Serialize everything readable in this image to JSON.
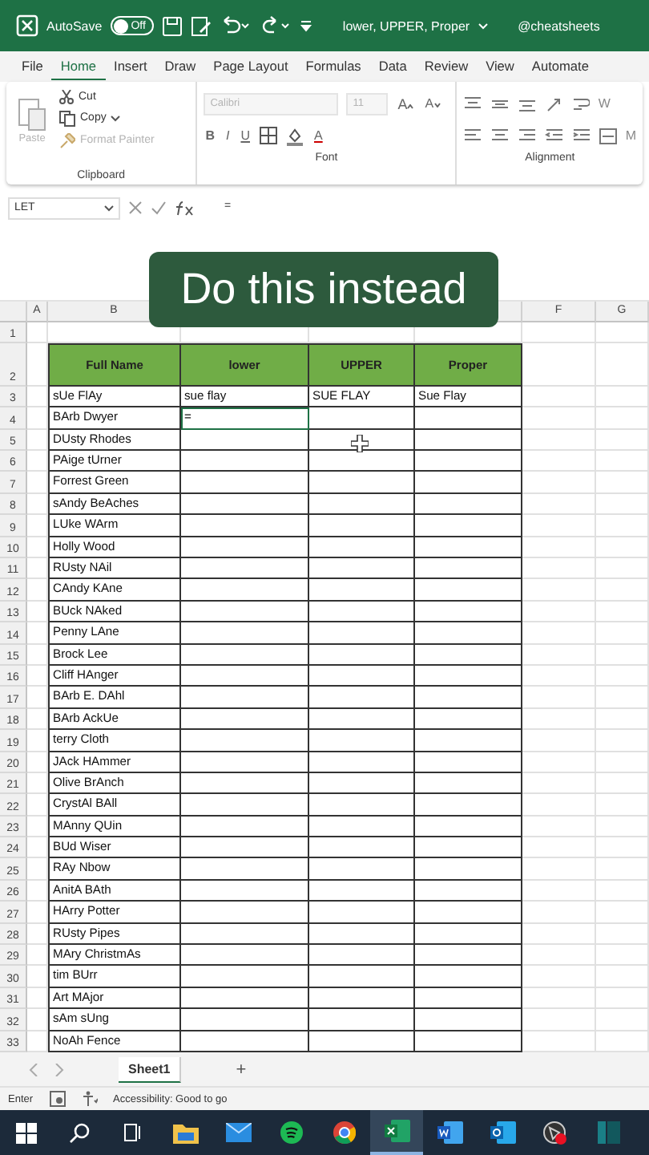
{
  "title_bar": {
    "autosave_label": "AutoSave",
    "autosave": {
      "on": false,
      "label": "Off"
    },
    "document_title": "lower, UPPER, Proper",
    "account": "@cheatsheets"
  },
  "menu_tabs": [
    {
      "label": "File",
      "selected": false
    },
    {
      "label": "Home",
      "selected": true
    },
    {
      "label": "Insert",
      "selected": false
    },
    {
      "label": "Draw",
      "selected": false
    },
    {
      "label": "Page Layout",
      "selected": false
    },
    {
      "label": "Formulas",
      "selected": false
    },
    {
      "label": "Data",
      "selected": false
    },
    {
      "label": "Review",
      "selected": false
    },
    {
      "label": "View",
      "selected": false
    },
    {
      "label": "Automate",
      "selected": false
    }
  ],
  "ribbon": {
    "clipboard": {
      "label": "Clipboard",
      "paste": {
        "label": "Paste",
        "disabled": true
      },
      "cut": {
        "label": "Cut",
        "disabled": false
      },
      "copy": {
        "label": "Copy",
        "disabled": false
      },
      "format_painter": {
        "label": "Format Painter",
        "disabled": true
      }
    },
    "font": {
      "label": "Font",
      "font_name": "Calibri",
      "font_size": "11",
      "disabled": true,
      "bold": "B",
      "italic": "I",
      "underline": "U",
      "font_color": "A",
      "grow": "A",
      "shrink": "A"
    },
    "alignment": {
      "label": "Alignment",
      "wrap": "W",
      "merge": "M"
    }
  },
  "formula_bar": {
    "name_box": "LET",
    "formula": "="
  },
  "caption": "Do this instead",
  "column_headers_left": [
    "A",
    "B"
  ],
  "column_headers_right": [
    "F",
    "G"
  ],
  "blank_row": {
    "number": "1"
  },
  "header_row": {
    "number": "2",
    "cells": [
      "Full Name",
      "lower",
      "UPPER",
      "Proper"
    ]
  },
  "rows": [
    {
      "number": "3",
      "cells": [
        "sUe FlAy",
        "sue flay",
        "SUE FLAY",
        "Sue Flay"
      ]
    },
    {
      "number": "4",
      "cells": [
        "BArb Dwyer",
        {
          "text": "=",
          "active": true
        }
      ]
    },
    {
      "number": "5",
      "cells": [
        "DUsty Rhodes"
      ]
    },
    {
      "number": "6",
      "cells": [
        "PAige tUrner"
      ]
    },
    {
      "number": "7",
      "cells": [
        "Forrest Green"
      ]
    },
    {
      "number": "8",
      "cells": [
        "sAndy BeAches"
      ]
    },
    {
      "number": "9",
      "cells": [
        "LUke WArm"
      ]
    },
    {
      "number": "10",
      "cells": [
        "Holly Wood"
      ]
    },
    {
      "number": "11",
      "cells": [
        "RUsty NAil"
      ]
    },
    {
      "number": "12",
      "cells": [
        "CAndy KAne"
      ]
    },
    {
      "number": "13",
      "cells": [
        "BUck NAked"
      ]
    },
    {
      "number": "14",
      "cells": [
        "Penny LAne"
      ]
    },
    {
      "number": "15",
      "cells": [
        "Brock Lee"
      ]
    },
    {
      "number": "16",
      "cells": [
        "Cliff HAnger"
      ]
    },
    {
      "number": "17",
      "cells": [
        "BArb E. DAhl"
      ]
    },
    {
      "number": "18",
      "cells": [
        "BArb AckUe"
      ]
    },
    {
      "number": "19",
      "cells": [
        "terry Cloth"
      ]
    },
    {
      "number": "20",
      "cells": [
        "JAck HAmmer"
      ]
    },
    {
      "number": "21",
      "cells": [
        "Olive BrAnch"
      ]
    },
    {
      "number": "22",
      "cells": [
        "CrystAl BAll"
      ]
    },
    {
      "number": "23",
      "cells": [
        "MAnny QUin"
      ]
    },
    {
      "number": "24",
      "cells": [
        "BUd Wiser"
      ]
    },
    {
      "number": "25",
      "cells": [
        "RAy Nbow"
      ]
    },
    {
      "number": "26",
      "cells": [
        "AnitA BAth"
      ]
    },
    {
      "number": "27",
      "cells": [
        "HArry Potter"
      ]
    },
    {
      "number": "28",
      "cells": [
        "RUsty Pipes"
      ]
    },
    {
      "number": "29",
      "cells": [
        "MAry ChristmAs"
      ]
    },
    {
      "number": "30",
      "cells": [
        "tim BUrr"
      ]
    },
    {
      "number": "31",
      "cells": [
        "Art MAjor"
      ]
    },
    {
      "number": "32",
      "cells": [
        "sAm sUng"
      ]
    },
    {
      "number": "33",
      "cells": [
        "NoAh Fence"
      ]
    }
  ],
  "sheet_tabs": [
    {
      "label": "Sheet1",
      "selected": true
    }
  ],
  "add_sheet": "+",
  "status_bar": {
    "mode": "Enter",
    "accessibility": "Accessibility: Good to go"
  },
  "taskbar": [
    {
      "kind": "start",
      "selected": false
    },
    {
      "kind": "search",
      "selected": false
    },
    {
      "kind": "taskview",
      "selected": false
    },
    {
      "kind": "folder",
      "selected": false
    },
    {
      "kind": "mail",
      "selected": false
    },
    {
      "kind": "music",
      "selected": false
    },
    {
      "kind": "browser",
      "selected": false
    },
    {
      "kind": "sheet",
      "selected": true
    },
    {
      "kind": "doc",
      "selected": false
    },
    {
      "kind": "outlook",
      "selected": false
    },
    {
      "kind": "record",
      "selected": false
    },
    {
      "kind": "panel",
      "selected": false
    }
  ]
}
